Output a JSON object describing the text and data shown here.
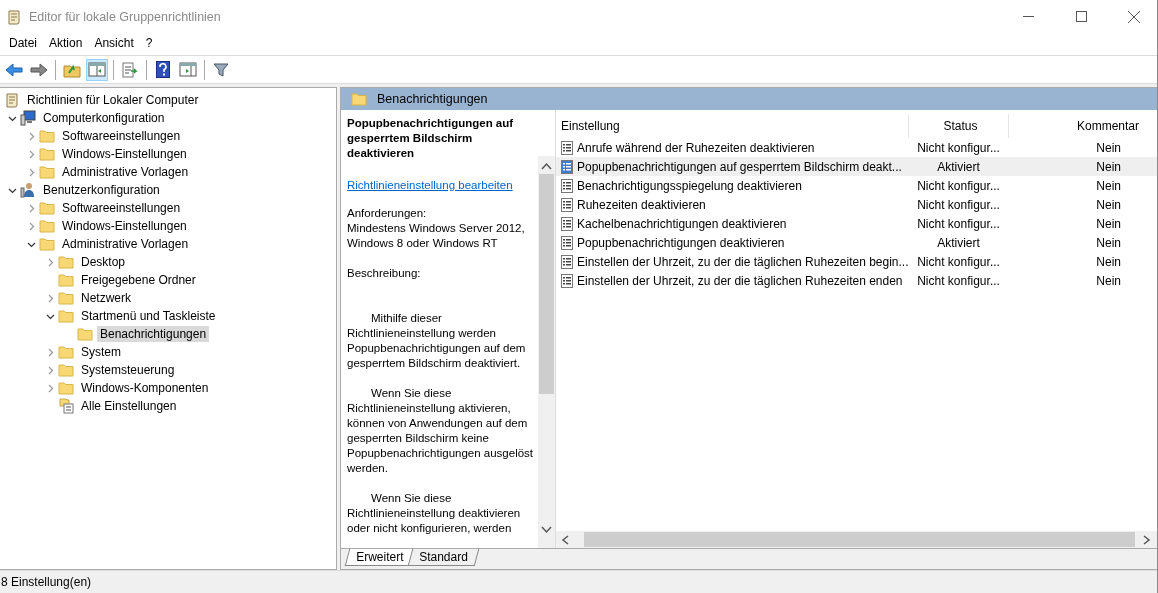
{
  "window": {
    "title": "Editor für lokale Gruppenrichtlinien"
  },
  "menu": [
    "Datei",
    "Aktion",
    "Ansicht",
    "?"
  ],
  "toolbar": [
    {
      "kind": "back",
      "pressed": false
    },
    {
      "kind": "forward",
      "pressed": false
    },
    {
      "kind": "sep"
    },
    {
      "kind": "up",
      "pressed": false
    },
    {
      "kind": "tree",
      "pressed": true
    },
    {
      "kind": "sep"
    },
    {
      "kind": "export",
      "pressed": false
    },
    {
      "kind": "sep"
    },
    {
      "kind": "help",
      "pressed": false
    },
    {
      "kind": "pane",
      "pressed": false
    },
    {
      "kind": "sep"
    },
    {
      "kind": "filter",
      "pressed": false
    }
  ],
  "tree": {
    "label": "Richtlinien für Lokaler Computer",
    "kind": "scroll",
    "children": [
      {
        "label": "Computerkonfiguration",
        "kind": "computer",
        "expanded": true,
        "selected": false,
        "children": [
          {
            "label": "Softwareeinstellungen",
            "kind": "folder",
            "expanded": false,
            "selected": false
          },
          {
            "label": "Windows-Einstellungen",
            "kind": "folder",
            "expanded": false,
            "selected": false
          },
          {
            "label": "Administrative Vorlagen",
            "kind": "folder",
            "expanded": false,
            "selected": false
          }
        ]
      },
      {
        "label": "Benutzerkonfiguration",
        "kind": "user",
        "expanded": true,
        "selected": false,
        "children": [
          {
            "label": "Softwareeinstellungen",
            "kind": "folder",
            "expanded": false,
            "selected": false
          },
          {
            "label": "Windows-Einstellungen",
            "kind": "folder",
            "expanded": false,
            "selected": false
          },
          {
            "label": "Administrative Vorlagen",
            "kind": "folder",
            "expanded": true,
            "selected": false,
            "children": [
              {
                "label": "Desktop",
                "kind": "folder",
                "expanded": false,
                "selected": false
              },
              {
                "label": "Freigegebene Ordner",
                "kind": "folder",
                "selected": false
              },
              {
                "label": "Netzwerk",
                "kind": "folder",
                "expanded": false,
                "selected": false
              },
              {
                "label": "Startmenü und Taskleiste",
                "kind": "folder",
                "expanded": true,
                "selected": false,
                "children": [
                  {
                    "label": "Benachrichtigungen",
                    "kind": "folder",
                    "selected": true
                  }
                ]
              },
              {
                "label": "System",
                "kind": "folder",
                "expanded": false,
                "selected": false
              },
              {
                "label": "Systemsteuerung",
                "kind": "folder",
                "expanded": false,
                "selected": false
              },
              {
                "label": "Windows-Komponenten",
                "kind": "folder",
                "expanded": false,
                "selected": false
              },
              {
                "label": "Alle Einstellungen",
                "kind": "settings",
                "selected": false
              }
            ]
          }
        ]
      }
    ]
  },
  "header": {
    "title": "Benachrichtigungen"
  },
  "description": {
    "title": "Popupbenachrichtigungen auf gesperrtem Bildschirm deaktivieren",
    "link": "Richtlinieneinstellung bearbeiten",
    "paragraphs": [
      {
        "text": "Anforderungen:\nMindestens Windows Server 2012, Windows 8 oder Windows RT",
        "indent": false
      },
      {
        "text": "Beschreibung:",
        "indent": false
      },
      {
        "text": "Mithilfe dieser Richtlinieneinstellung werden Popupbenachrichtigungen auf dem gesperrtem Bildschirm deaktiviert.",
        "indent": true
      },
      {
        "text": "Wenn Sie diese Richtlinieneinstellung aktivieren, können von Anwendungen auf dem gesperrten Bildschirm keine Popupbenachrichtigungen ausgelöst werden.",
        "indent": true
      },
      {
        "text": "Wenn Sie diese Richtlinieneinstellung deaktivieren oder nicht konfigurieren, werden",
        "indent": true
      }
    ]
  },
  "table": {
    "columns": [
      "Einstellung",
      "Status",
      "Kommentar"
    ],
    "rows": [
      {
        "setting": "Anrufe während der Ruhezeiten deaktivieren",
        "status": "Nicht konfigur...",
        "comment": "Nein",
        "selected": false
      },
      {
        "setting": "Popupbenachrichtigungen auf gesperrtem Bildschirm deakt...",
        "status": "Aktiviert",
        "comment": "Nein",
        "selected": true
      },
      {
        "setting": "Benachrichtigungsspiegelung deaktivieren",
        "status": "Nicht konfigur...",
        "comment": "Nein",
        "selected": false
      },
      {
        "setting": "Ruhezeiten deaktivieren",
        "status": "Nicht konfigur...",
        "comment": "Nein",
        "selected": false
      },
      {
        "setting": "Kachelbenachrichtigungen deaktivieren",
        "status": "Nicht konfigur...",
        "comment": "Nein",
        "selected": false
      },
      {
        "setting": "Popupbenachrichtigungen deaktivieren",
        "status": "Aktiviert",
        "comment": "Nein",
        "selected": false
      },
      {
        "setting": "Einstellen der Uhrzeit, zu der die täglichen Ruhezeiten begin...",
        "status": "Nicht konfigur...",
        "comment": "Nein",
        "selected": false
      },
      {
        "setting": "Einstellen der Uhrzeit, zu der die täglichen Ruhezeiten enden",
        "status": "Nicht konfigur...",
        "comment": "Nein",
        "selected": false
      }
    ]
  },
  "tabs": [
    {
      "label": "Erweitert",
      "selected": true
    },
    {
      "label": "Standard",
      "selected": false
    }
  ],
  "status_bar": {
    "text": "8 Einstellung(en)"
  }
}
